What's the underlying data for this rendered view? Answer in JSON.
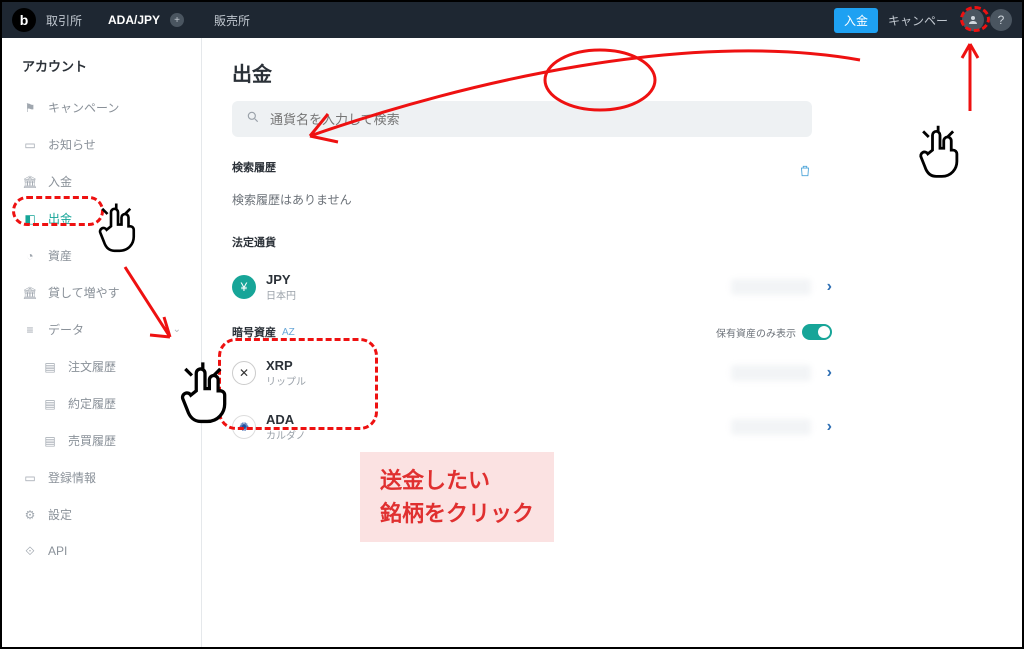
{
  "topbar": {
    "exchange_label": "取引所",
    "pair": "ADA/JPY",
    "sales_label": "販売所",
    "deposit_button": "入金",
    "campaign_link": "キャンペー"
  },
  "sidebar": {
    "title": "アカウント",
    "items": [
      {
        "label": "キャンペーン"
      },
      {
        "label": "お知らせ"
      },
      {
        "label": "入金"
      },
      {
        "label": "出金"
      },
      {
        "label": "資産"
      },
      {
        "label": "貸して増やす"
      },
      {
        "label": "データ"
      },
      {
        "label": "注文履歴"
      },
      {
        "label": "約定履歴"
      },
      {
        "label": "売買履歴"
      },
      {
        "label": "登録情報"
      },
      {
        "label": "設定"
      },
      {
        "label": "API"
      }
    ]
  },
  "main": {
    "title": "出金",
    "search_placeholder": "通貨名を入力して検索",
    "history_label": "検索履歴",
    "history_empty": "検索履歴はありません",
    "fiat_label": "法定通貨",
    "crypto_label": "暗号資産",
    "sort_label": "AZ",
    "holdings_only_label": "保有資産のみ表示",
    "fiat": [
      {
        "symbol": "JPY",
        "name": "日本円"
      }
    ],
    "crypto": [
      {
        "symbol": "XRP",
        "name": "リップル"
      },
      {
        "symbol": "ADA",
        "name": "カルダノ"
      }
    ]
  },
  "annotation": {
    "callout_line1": "送金したい",
    "callout_line2": "銘柄をクリック"
  }
}
